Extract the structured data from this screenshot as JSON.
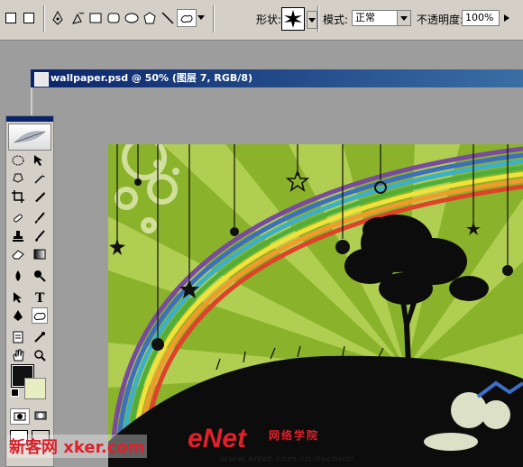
{
  "options_bar": {
    "shape_label": "形状:",
    "mode_label": "模式:",
    "mode_value": "正常",
    "opacity_label": "不透明度:",
    "opacity_value": "100%"
  },
  "document": {
    "title": "wallpaper.psd @ 50% (图层 7, RGB/8)"
  },
  "icons": {
    "toolbar": [
      "pen-tool-icon",
      "freeform-pen-icon",
      "shape-layers-icon",
      "rectangle-icon",
      "rounded-rectangle-icon",
      "ellipse-icon",
      "polygon-icon",
      "line-icon",
      "custom-shape-icon"
    ],
    "tools": [
      "marquee",
      "move",
      "lasso",
      "magic-wand",
      "crop",
      "slice",
      "healing-brush",
      "brush",
      "clone-stamp",
      "history-brush",
      "eraser",
      "gradient",
      "blur",
      "dodge",
      "path-selection",
      "type",
      "pen",
      "custom-shape",
      "notes",
      "eyedropper",
      "hand",
      "zoom"
    ]
  },
  "colors": {
    "foreground": "#111111",
    "background": "#e8edc2",
    "canvas_green": "#8ab22a",
    "title_bar": "#0a246a"
  },
  "watermarks": {
    "left": "新客网 xker.com",
    "center": "eNet",
    "center_cn": "网络学院",
    "url": "www.eNet.com.cn/eschool"
  }
}
